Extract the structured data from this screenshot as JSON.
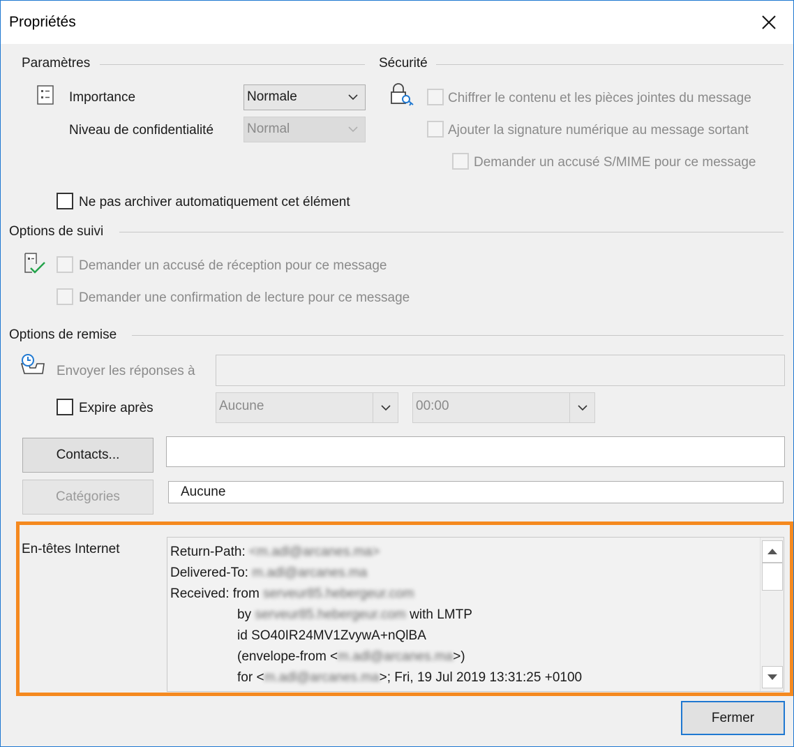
{
  "dialog": {
    "title": "Propriétés"
  },
  "parametres": {
    "heading": "Paramètres",
    "importance_label": "Importance",
    "importance_value": "Normale",
    "confidentialite_label": "Niveau de confidentialité",
    "confidentialite_value": "Normal",
    "no_archive_label": "Ne pas archiver automatiquement cet élément"
  },
  "securite": {
    "heading": "Sécurité",
    "encrypt_label": "Chiffrer le contenu et les pièces jointes du message",
    "sign_label": "Ajouter la signature numérique au message sortant",
    "smime_label": "Demander un accusé S/MIME pour ce message"
  },
  "suivi": {
    "heading": "Options de suivi",
    "delivery_receipt_label": "Demander un accusé de réception pour ce message",
    "read_receipt_label": "Demander une confirmation de lecture pour ce message"
  },
  "remise": {
    "heading": "Options de remise",
    "reply_to_label": "Envoyer les réponses à",
    "reply_to_value": "",
    "expire_label": "Expire après",
    "expire_date": "Aucune",
    "expire_time": "00:00"
  },
  "contacts": {
    "button_label": "Contacts...",
    "value": ""
  },
  "categories": {
    "button_label": "Catégories",
    "value": "Aucune"
  },
  "headers": {
    "label": "En-têtes Internet",
    "lines": [
      {
        "key": "Return-Path: ",
        "blurred": "<m.adl@arcanes.ma>",
        "tail": "",
        "indent": false
      },
      {
        "key": "Delivered-To: ",
        "blurred": "m.adl@arcanes.ma",
        "tail": "",
        "indent": false
      },
      {
        "key": "Received: from ",
        "blurred": "serveur85.hebergeur.com",
        "tail": "",
        "indent": false
      },
      {
        "key": "by ",
        "blurred": "serveur85.hebergeur.com",
        "tail": " with LMTP",
        "indent": true
      },
      {
        "key": "id SO40IR24MV1ZvywA+nQlBA",
        "blurred": "",
        "tail": "",
        "indent": true
      },
      {
        "key": "(envelope-from <",
        "blurred": "m.adl@arcanes.ma",
        "tail": ">)",
        "indent": true
      },
      {
        "key": "for <",
        "blurred": "m.adl@arcanes.ma",
        "tail": ">; Fri, 19 Jul 2019 13:31:25 +0100",
        "indent": true
      }
    ]
  },
  "footer": {
    "close_label": "Fermer"
  },
  "colors": {
    "highlight": "#f5891f",
    "accent": "#1f78d1"
  }
}
